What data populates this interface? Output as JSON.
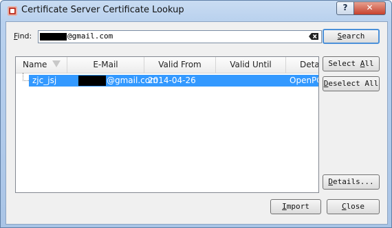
{
  "window": {
    "title": "Certificate Server Certificate Lookup",
    "help_label": "?",
    "close_label": "✕"
  },
  "find": {
    "label_key": "F",
    "label_rest": "ind:",
    "value_suffix": "@gmail.com"
  },
  "buttons": {
    "search": {
      "key": "S",
      "rest": "earch"
    },
    "select_all": {
      "pre": "Select ",
      "key": "A",
      "rest": "ll"
    },
    "deselect_all": {
      "key": "D",
      "rest": "eselect All"
    },
    "details": {
      "key": "D",
      "rest": "etails..."
    },
    "import": {
      "key": "I",
      "rest": "mport"
    },
    "close": {
      "key": "C",
      "rest": "lose"
    }
  },
  "table": {
    "columns": [
      "Name",
      "E-Mail",
      "Valid From",
      "Valid Until",
      "Deta"
    ],
    "rows": [
      {
        "name": "zjc_jsj",
        "email_suffix": "@gmail.com",
        "valid_from": "2014-04-26",
        "valid_until": "",
        "details": "OpenPG"
      }
    ]
  },
  "colors": {
    "selection": "#3399ff",
    "title_bar": "#b9d1ee",
    "close_button": "#c7412d"
  }
}
